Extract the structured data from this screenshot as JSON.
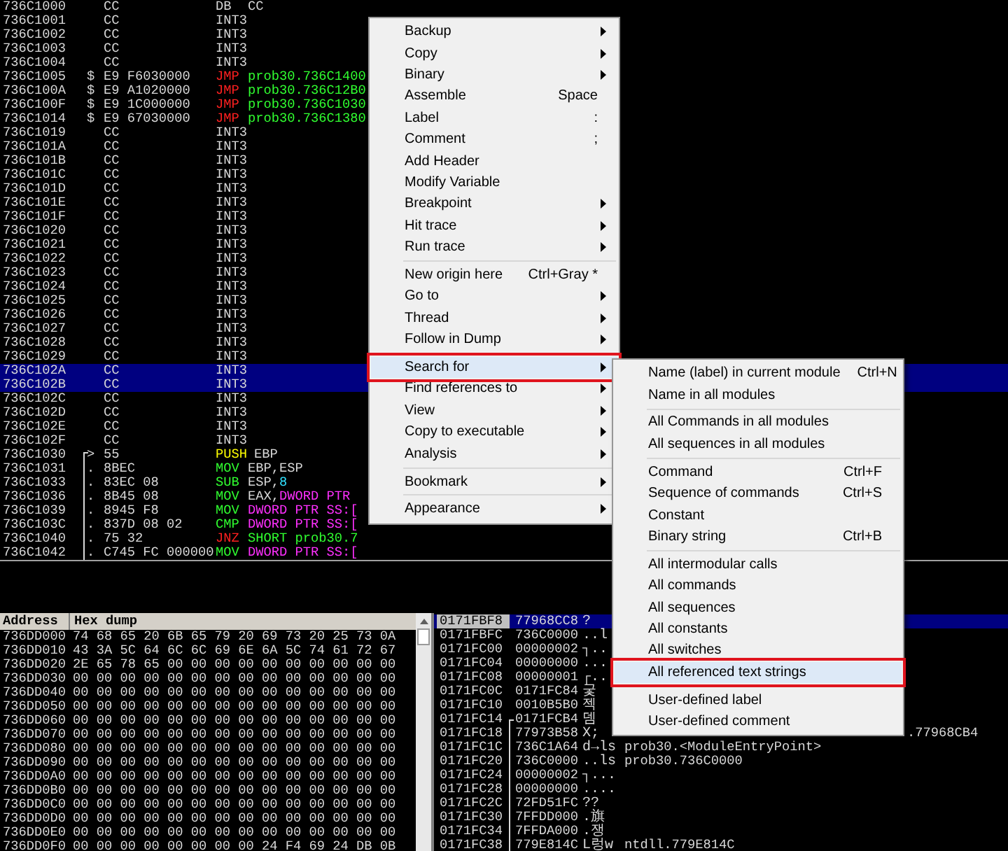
{
  "disassembly": {
    "rows": [
      {
        "address": "736C1000",
        "hex": "CC",
        "mnemonic": "DB",
        "kind": "plain",
        "operand": [
          {
            "text": "CC",
            "kind": "plain"
          }
        ],
        "selected": false
      },
      {
        "address": "736C1001",
        "hex": "CC",
        "mnemonic": "INT3",
        "kind": "plain",
        "selected": false
      },
      {
        "address": "736C1002",
        "hex": "CC",
        "mnemonic": "INT3",
        "kind": "plain",
        "selected": false
      },
      {
        "address": "736C1003",
        "hex": "CC",
        "mnemonic": "INT3",
        "kind": "plain",
        "selected": false
      },
      {
        "address": "736C1004",
        "hex": "CC",
        "mnemonic": "INT3",
        "kind": "plain",
        "selected": false
      },
      {
        "address": "736C1005",
        "marker": "$",
        "hex": "E9 F6030000",
        "mnemonic": "JMP",
        "kind": "jump",
        "operand": [
          {
            "text": "prob30.736C1400",
            "kind": "target"
          }
        ],
        "selected": false
      },
      {
        "address": "736C100A",
        "marker": "$",
        "hex": "E9 A1020000",
        "mnemonic": "JMP",
        "kind": "jump",
        "operand": [
          {
            "text": "prob30.736C12B0",
            "kind": "target"
          }
        ],
        "selected": false
      },
      {
        "address": "736C100F",
        "marker": "$",
        "hex": "E9 1C000000",
        "mnemonic": "JMP",
        "kind": "jump",
        "operand": [
          {
            "text": "prob30.736C1030",
            "kind": "target"
          }
        ],
        "selected": false
      },
      {
        "address": "736C1014",
        "marker": "$",
        "hex": "E9 67030000",
        "mnemonic": "JMP",
        "kind": "jump",
        "operand": [
          {
            "text": "prob30.736C1380",
            "kind": "target"
          }
        ],
        "selected": false
      },
      {
        "address": "736C1019",
        "hex": "CC",
        "mnemonic": "INT3",
        "kind": "plain",
        "selected": false
      },
      {
        "address": "736C101A",
        "hex": "CC",
        "mnemonic": "INT3",
        "kind": "plain",
        "selected": false
      },
      {
        "address": "736C101B",
        "hex": "CC",
        "mnemonic": "INT3",
        "kind": "plain",
        "selected": false
      },
      {
        "address": "736C101C",
        "hex": "CC",
        "mnemonic": "INT3",
        "kind": "plain",
        "selected": false
      },
      {
        "address": "736C101D",
        "hex": "CC",
        "mnemonic": "INT3",
        "kind": "plain",
        "selected": false
      },
      {
        "address": "736C101E",
        "hex": "CC",
        "mnemonic": "INT3",
        "kind": "plain",
        "selected": false
      },
      {
        "address": "736C101F",
        "hex": "CC",
        "mnemonic": "INT3",
        "kind": "plain",
        "selected": false
      },
      {
        "address": "736C1020",
        "hex": "CC",
        "mnemonic": "INT3",
        "kind": "plain",
        "selected": false
      },
      {
        "address": "736C1021",
        "hex": "CC",
        "mnemonic": "INT3",
        "kind": "plain",
        "selected": false
      },
      {
        "address": "736C1022",
        "hex": "CC",
        "mnemonic": "INT3",
        "kind": "plain",
        "selected": false
      },
      {
        "address": "736C1023",
        "hex": "CC",
        "mnemonic": "INT3",
        "kind": "plain",
        "selected": false
      },
      {
        "address": "736C1024",
        "hex": "CC",
        "mnemonic": "INT3",
        "kind": "plain",
        "selected": false
      },
      {
        "address": "736C1025",
        "hex": "CC",
        "mnemonic": "INT3",
        "kind": "plain",
        "selected": false
      },
      {
        "address": "736C1026",
        "hex": "CC",
        "mnemonic": "INT3",
        "kind": "plain",
        "selected": false
      },
      {
        "address": "736C1027",
        "hex": "CC",
        "mnemonic": "INT3",
        "kind": "plain",
        "selected": false
      },
      {
        "address": "736C1028",
        "hex": "CC",
        "mnemonic": "INT3",
        "kind": "plain",
        "selected": false
      },
      {
        "address": "736C1029",
        "hex": "CC",
        "mnemonic": "INT3",
        "kind": "plain",
        "selected": false
      },
      {
        "address": "736C102A",
        "hex": "CC",
        "mnemonic": "INT3",
        "kind": "plain",
        "selected": true
      },
      {
        "address": "736C102B",
        "hex": "CC",
        "mnemonic": "INT3",
        "kind": "plain",
        "selected": true
      },
      {
        "address": "736C102C",
        "hex": "CC",
        "mnemonic": "INT3",
        "kind": "plain",
        "selected": false
      },
      {
        "address": "736C102D",
        "hex": "CC",
        "mnemonic": "INT3",
        "kind": "plain",
        "selected": false
      },
      {
        "address": "736C102E",
        "hex": "CC",
        "mnemonic": "INT3",
        "kind": "plain",
        "selected": false
      },
      {
        "address": "736C102F",
        "hex": "CC",
        "mnemonic": "INT3",
        "kind": "plain",
        "selected": false
      },
      {
        "address": "736C1030",
        "marker": ">",
        "hex": "55",
        "mnemonic": "PUSH",
        "kind": "push",
        "operand": [
          {
            "text": "EBP",
            "kind": "plain"
          }
        ],
        "selected": false
      },
      {
        "address": "736C1031",
        "marker": ".",
        "hex": "8BEC",
        "mnemonic": "MOV",
        "kind": "move",
        "operand": [
          {
            "text": "EBP,ESP",
            "kind": "plain"
          }
        ],
        "selected": false
      },
      {
        "address": "736C1033",
        "marker": ".",
        "hex": "83EC 08",
        "mnemonic": "SUB",
        "kind": "move",
        "operand": [
          {
            "text": "ESP,",
            "kind": "plain"
          },
          {
            "text": "8",
            "kind": "constant"
          }
        ],
        "selected": false
      },
      {
        "address": "736C1036",
        "marker": ".",
        "hex": "8B45 08",
        "mnemonic": "MOV",
        "kind": "move",
        "operand": [
          {
            "text": "EAX,",
            "kind": "plain"
          },
          {
            "text": "DWORD PTR",
            "kind": "memory"
          }
        ],
        "selected": false
      },
      {
        "address": "736C1039",
        "marker": ".",
        "hex": "8945 F8",
        "mnemonic": "MOV",
        "kind": "move",
        "operand": [
          {
            "text": "DWORD PTR SS:[",
            "kind": "memory"
          }
        ],
        "selected": false
      },
      {
        "address": "736C103C",
        "marker": ".",
        "hex": "837D 08 02",
        "mnemonic": "CMP",
        "kind": "move",
        "operand": [
          {
            "text": "DWORD PTR SS:[",
            "kind": "memory"
          }
        ],
        "selected": false
      },
      {
        "address": "736C1040",
        "marker": ".",
        "hex": "75 32",
        "mnemonic": "JNZ",
        "kind": "jump",
        "operand": [
          {
            "text": "SHORT prob30.7",
            "kind": "target"
          }
        ],
        "selected": false
      },
      {
        "address": "736C1042",
        "marker": ".",
        "hex": "C745 FC 000000",
        "mnemonic": "MOV",
        "kind": "move",
        "operand": [
          {
            "text": "DWORD PTR SS:[",
            "kind": "memory"
          }
        ],
        "selected": false
      }
    ]
  },
  "dump": {
    "columns": [
      "Address",
      "Hex dump"
    ],
    "rows": [
      {
        "address": "736DD000",
        "hex": "74 68 65 20 6B 65 79 20 69 73 20 25 73 0A"
      },
      {
        "address": "736DD010",
        "hex": "43 3A 5C 64 6C 6C 69 6E 6A 5C 74 61 72 67"
      },
      {
        "address": "736DD020",
        "hex": "2E 65 78 65 00 00 00 00 00 00 00 00 00 00"
      },
      {
        "address": "736DD030",
        "hex": "00 00 00 00 00 00 00 00 00 00 00 00 00 00"
      },
      {
        "address": "736DD040",
        "hex": "00 00 00 00 00 00 00 00 00 00 00 00 00 00"
      },
      {
        "address": "736DD050",
        "hex": "00 00 00 00 00 00 00 00 00 00 00 00 00 00"
      },
      {
        "address": "736DD060",
        "hex": "00 00 00 00 00 00 00 00 00 00 00 00 00 00"
      },
      {
        "address": "736DD070",
        "hex": "00 00 00 00 00 00 00 00 00 00 00 00 00 00"
      },
      {
        "address": "736DD080",
        "hex": "00 00 00 00 00 00 00 00 00 00 00 00 00 00"
      },
      {
        "address": "736DD090",
        "hex": "00 00 00 00 00 00 00 00 00 00 00 00 00 00"
      },
      {
        "address": "736DD0A0",
        "hex": "00 00 00 00 00 00 00 00 00 00 00 00 00 00"
      },
      {
        "address": "736DD0B0",
        "hex": "00 00 00 00 00 00 00 00 00 00 00 00 00 00"
      },
      {
        "address": "736DD0C0",
        "hex": "00 00 00 00 00 00 00 00 00 00 00 00 00 00"
      },
      {
        "address": "736DD0D0",
        "hex": "00 00 00 00 00 00 00 00 00 00 00 00 00 00"
      },
      {
        "address": "736DD0E0",
        "hex": "00 00 00 00 00 00 00 00 00 00 00 00 00 00"
      },
      {
        "address": "736DD0F0",
        "hex": "00 00 00 00 00 00 00 00 24 F4 69 24 DB 0B"
      }
    ]
  },
  "stack": {
    "rows": [
      {
        "address": "0171FBF8",
        "value": "77968CC8",
        "ascii": "?",
        "selected": true
      },
      {
        "address": "0171FBFC",
        "value": "736C0000",
        "ascii": "..l",
        "selected": false
      },
      {
        "address": "0171FC00",
        "value": "00000002",
        "ascii": "┐..",
        "selected": false
      },
      {
        "address": "0171FC04",
        "value": "00000000",
        "ascii": "...",
        "selected": false
      },
      {
        "address": "0171FC08",
        "value": "00000001",
        "ascii": "┌..",
        "selected": false
      },
      {
        "address": "0171FC0C",
        "value": "0171FC84",
        "ascii": "궃",
        "selected": false
      },
      {
        "address": "0171FC10",
        "value": "0010B5B0",
        "ascii": "젝",
        "selected": false
      },
      {
        "address": "0171FC14",
        "value": "0171FCB4",
        "ascii": "뎀",
        "selected": false
      },
      {
        "address": "0171FC18",
        "value": "77973B58",
        "ascii": "X;",
        "comment": {
          "text": ".77968CB4",
          "kind": "tail"
        },
        "selected": false
      },
      {
        "address": "0171FC1C",
        "value": "736C1A64",
        "ascii": "d→ls",
        "comment": {
          "text": "prob30.<ModuleEntryPoint>",
          "kind": "full"
        },
        "selected": false
      },
      {
        "address": "0171FC20",
        "value": "736C0000",
        "ascii": "..ls",
        "comment": {
          "text": "prob30.736C0000",
          "kind": "full"
        },
        "selected": false
      },
      {
        "address": "0171FC24",
        "value": "00000002",
        "ascii": "┐...",
        "selected": false
      },
      {
        "address": "0171FC28",
        "value": "00000000",
        "ascii": "....",
        "selected": false
      },
      {
        "address": "0171FC2C",
        "value": "72FD51FC",
        "ascii": "??",
        "selected": false
      },
      {
        "address": "0171FC30",
        "value": "7FFDD000",
        "ascii": ".旗",
        "selected": false
      },
      {
        "address": "0171FC34",
        "value": "7FFDA000",
        "ascii": ".쟁",
        "selected": false
      },
      {
        "address": "0171FC38",
        "value": "779E814C",
        "ascii": "L렁w",
        "comment": {
          "text": "ntdll.779E814C",
          "kind": "full"
        },
        "selected": false
      }
    ]
  },
  "context_menu": {
    "items": [
      {
        "kind": "item",
        "label": "Backup",
        "submenu": true,
        "selected": false
      },
      {
        "kind": "item",
        "label": "Copy",
        "submenu": true,
        "selected": false
      },
      {
        "kind": "item",
        "label": "Binary",
        "submenu": true,
        "selected": false
      },
      {
        "kind": "item",
        "label": "Assemble",
        "shortcut": "Space",
        "submenu": false,
        "selected": false
      },
      {
        "kind": "item",
        "label": "Label",
        "shortcut": ":",
        "submenu": false,
        "selected": false
      },
      {
        "kind": "item",
        "label": "Comment",
        "shortcut": ";",
        "submenu": false,
        "selected": false
      },
      {
        "kind": "item",
        "label": "Add Header",
        "submenu": false,
        "selected": false
      },
      {
        "kind": "item",
        "label": "Modify Variable",
        "submenu": false,
        "selected": false
      },
      {
        "kind": "item",
        "label": "Breakpoint",
        "submenu": true,
        "selected": false
      },
      {
        "kind": "item",
        "label": "Hit trace",
        "submenu": true,
        "selected": false
      },
      {
        "kind": "item",
        "label": "Run trace",
        "submenu": true,
        "selected": false
      },
      {
        "kind": "separator"
      },
      {
        "kind": "item",
        "label": "New origin here",
        "shortcut": "Ctrl+Gray *",
        "submenu": false,
        "selected": false
      },
      {
        "kind": "item",
        "label": "Go to",
        "submenu": true,
        "selected": false
      },
      {
        "kind": "item",
        "label": "Thread",
        "submenu": true,
        "selected": false
      },
      {
        "kind": "item",
        "label": "Follow in Dump",
        "submenu": true,
        "selected": false
      },
      {
        "kind": "separator"
      },
      {
        "kind": "item",
        "label": "Search for",
        "submenu": true,
        "selected": true
      },
      {
        "kind": "item",
        "label": "Find references to",
        "submenu": true,
        "selected": false
      },
      {
        "kind": "item",
        "label": "View",
        "submenu": true,
        "selected": false
      },
      {
        "kind": "item",
        "label": "Copy to executable",
        "submenu": true,
        "selected": false
      },
      {
        "kind": "item",
        "label": "Analysis",
        "submenu": true,
        "selected": false
      },
      {
        "kind": "separator"
      },
      {
        "kind": "item",
        "label": "Bookmark",
        "submenu": true,
        "selected": false
      },
      {
        "kind": "separator"
      },
      {
        "kind": "item",
        "label": "Appearance",
        "submenu": true,
        "selected": false
      }
    ]
  },
  "submenu": {
    "items": [
      {
        "kind": "item",
        "label": "Name (label) in current module",
        "shortcut": "Ctrl+N",
        "selected": false
      },
      {
        "kind": "item",
        "label": "Name in all modules",
        "selected": false
      },
      {
        "kind": "separator"
      },
      {
        "kind": "item",
        "label": "All Commands in all modules",
        "selected": false
      },
      {
        "kind": "item",
        "label": "All sequences in all modules",
        "selected": false
      },
      {
        "kind": "separator"
      },
      {
        "kind": "item",
        "label": "Command",
        "shortcut": "Ctrl+F",
        "selected": false
      },
      {
        "kind": "item",
        "label": "Sequence of commands",
        "shortcut": "Ctrl+S",
        "selected": false
      },
      {
        "kind": "item",
        "label": "Constant",
        "selected": false
      },
      {
        "kind": "item",
        "label": "Binary string",
        "shortcut": "Ctrl+B",
        "selected": false
      },
      {
        "kind": "separator"
      },
      {
        "kind": "item",
        "label": "All intermodular calls",
        "selected": false
      },
      {
        "kind": "item",
        "label": "All commands",
        "selected": false
      },
      {
        "kind": "item",
        "label": "All sequences",
        "selected": false
      },
      {
        "kind": "item",
        "label": "All constants",
        "selected": false
      },
      {
        "kind": "item",
        "label": "All switches",
        "selected": false
      },
      {
        "kind": "item",
        "label": "All referenced text strings",
        "selected": true
      },
      {
        "kind": "separator"
      },
      {
        "kind": "item",
        "label": "User-defined label",
        "selected": false
      },
      {
        "kind": "item",
        "label": "User-defined comment",
        "selected": false
      }
    ]
  }
}
